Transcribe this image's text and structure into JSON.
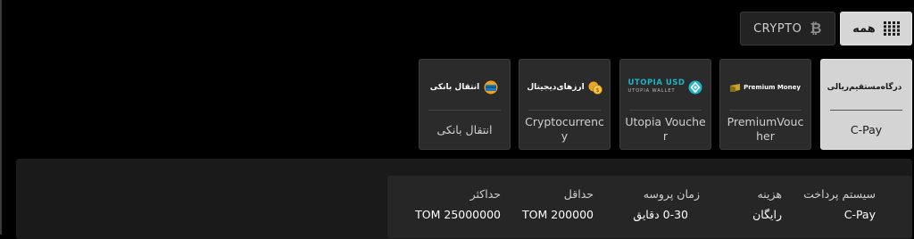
{
  "filters": {
    "crypto_label": "CRYPTO",
    "crypto_icon": "bitcoin-icon",
    "all_label": "همه",
    "all_icon": "grid-icon"
  },
  "cards": [
    {
      "id": "c-pay",
      "label": "C-Pay",
      "logo_text": "درگاه‌مستقیم‌ریالی",
      "icon": "card-wallet-icon",
      "selected": true
    },
    {
      "id": "premium-voucher",
      "label": "PremiumVoucher",
      "logo_text": "Premium Money",
      "icon": "premium-money-icon",
      "selected": false
    },
    {
      "id": "utopia-voucher",
      "label": "Utopia Voucher",
      "logo_text": "UTOPIA USD",
      "logo_sub": "UTOPIA WALLET",
      "icon": "utopia-icon",
      "selected": false
    },
    {
      "id": "cryptocurrency",
      "label": "Cryptocurrency",
      "logo_text": "ارزهای‌دیجیتال",
      "icon": "coins-icon",
      "selected": false
    },
    {
      "id": "bank-transfer",
      "label": "انتقال بانکی",
      "logo_text": "انتقال بانکی",
      "icon": "bank-card-icon",
      "selected": false
    }
  ],
  "details": {
    "headers": {
      "method": "سیستم پرداخت",
      "fee": "هزینه",
      "time": "زمان پروسه",
      "min": "حداقل",
      "max": "حداکثر"
    },
    "values": {
      "method": "C-Pay",
      "fee": "رایگان",
      "time": "0-30 دقایق",
      "min": "TOM 200000",
      "max": "TOM 25000000"
    }
  },
  "colors": {
    "background": "#000000",
    "card": "#2b2b2b",
    "card_selected": "#d4d4d4",
    "panel": "#1a1a1a",
    "utopia_accent": "#1fb3c8"
  }
}
